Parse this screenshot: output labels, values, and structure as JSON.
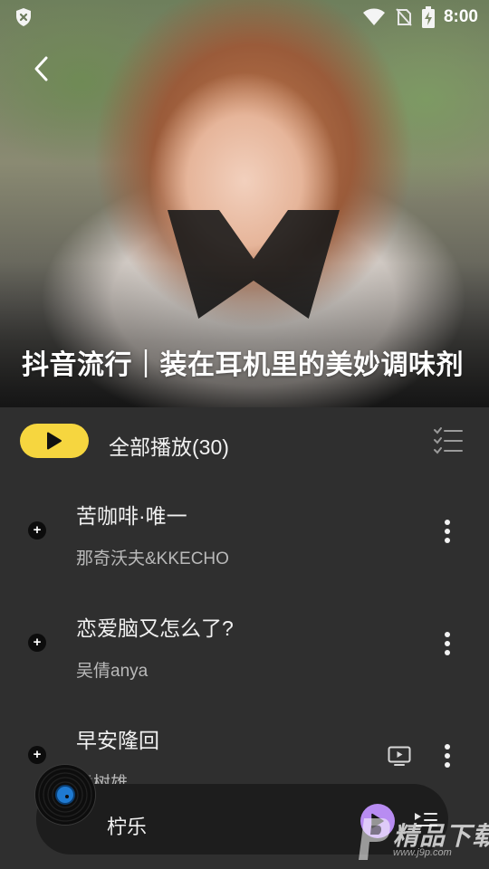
{
  "status_bar": {
    "time": "8:00",
    "icons": [
      "shield-x-icon",
      "wifi-icon",
      "no-sim-icon",
      "battery-charging-icon"
    ]
  },
  "header": {
    "back_icon": "chevron-left-icon",
    "playlist_title": "抖音流行｜装在耳机里的美妙调味剂"
  },
  "controls": {
    "play_all_label": "全部播放(30)",
    "play_icon": "play-icon",
    "list_select_icon": "checklist-icon",
    "accent_color": "#f6d63f"
  },
  "songs": [
    {
      "title": "苦咖啡·唯一",
      "artist": "那奇沃夫&KKECHO",
      "has_mv": false
    },
    {
      "title": "恋爱脑又怎么了?",
      "artist": "吴倩anya",
      "has_mv": false
    },
    {
      "title": "早安隆回",
      "artist": "袁树雄",
      "has_mv": true
    }
  ],
  "mini_player": {
    "title": "柠乐",
    "play_color": "#b88cf2",
    "icons": [
      "vinyl-disc-icon",
      "play-icon",
      "queue-icon"
    ]
  },
  "watermark": {
    "text": "精品下载",
    "sub": "www.j9p.com"
  }
}
